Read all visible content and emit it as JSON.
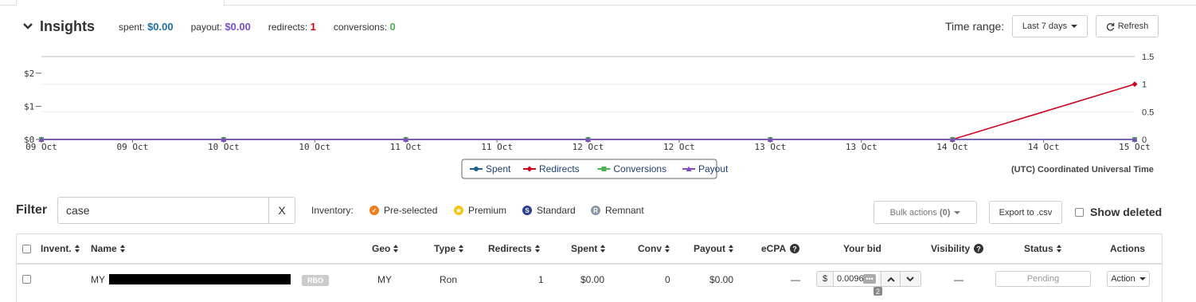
{
  "header": {
    "title": "Insights",
    "stats": {
      "spent_label": "spent:",
      "spent_value": "$0.00",
      "payout_label": "payout:",
      "payout_value": "$0.00",
      "redirects_label": "redirects:",
      "redirects_value": "1",
      "conversions_label": "conversions:",
      "conversions_value": "0"
    },
    "time_range_label": "Time range:",
    "time_range_value": "Last 7 days",
    "refresh_label": "Refresh"
  },
  "chart_data": {
    "type": "line",
    "x_ticks": [
      "09 Oct",
      "09 Oct",
      "10 Oct",
      "10 Oct",
      "11 Oct",
      "11 Oct",
      "12 Oct",
      "12 Oct",
      "13 Oct",
      "13 Oct",
      "14 Oct",
      "14 Oct",
      "15 Oct"
    ],
    "x": [
      "09 Oct",
      "10 Oct",
      "11 Oct",
      "12 Oct",
      "13 Oct",
      "14 Oct",
      "15 Oct"
    ],
    "left_axis": {
      "ticks": [
        "$0",
        "$1",
        "$2"
      ],
      "ylim": [
        0,
        2.5
      ]
    },
    "right_axis": {
      "ticks": [
        "0",
        "0.5",
        "1",
        "1.5"
      ],
      "ylim": [
        0,
        1.5
      ]
    },
    "series": [
      {
        "name": "Spent",
        "axis": "left",
        "color": "#1f5f8b",
        "values": [
          0,
          0,
          0,
          0,
          0,
          0,
          0
        ]
      },
      {
        "name": "Redirects",
        "axis": "right",
        "color": "#d0021b",
        "values": [
          0,
          0,
          0,
          0,
          0,
          0,
          1
        ]
      },
      {
        "name": "Conversions",
        "axis": "right",
        "color": "#4caf50",
        "values": [
          0,
          0,
          0,
          0,
          0,
          0,
          0
        ]
      },
      {
        "name": "Payout",
        "axis": "left",
        "color": "#7a4fc5",
        "values": [
          0,
          0,
          0,
          0,
          0,
          0,
          0
        ]
      }
    ],
    "grid": true,
    "legend_position": "bottom-center",
    "timezone_note": "(UTC) Coordinated Universal Time"
  },
  "filter": {
    "label": "Filter",
    "value": "case",
    "clear_label": "X",
    "inventory_label": "Inventory:",
    "inventory_items": [
      {
        "label": "Pre-selected",
        "color": "#f07d1e"
      },
      {
        "label": "Premium",
        "color": "#f5c518"
      },
      {
        "label": "Standard",
        "color": "#2a3f8f"
      },
      {
        "label": "Remnant",
        "color": "#8a97a8"
      }
    ],
    "bulk_actions_label": "Bulk actions",
    "bulk_count": "(0)",
    "export_label": "Export to .csv",
    "show_deleted_label": "Show deleted"
  },
  "table": {
    "columns": [
      "Invent.",
      "Name",
      "Geo",
      "Type",
      "Redirects",
      "Spent",
      "Conv",
      "Payout",
      "eCPA",
      "Your bid",
      "Visibility",
      "Status",
      "Actions"
    ],
    "rows": [
      {
        "name": "MY",
        "tag": "RBO",
        "geo": "MY",
        "type": "Ron",
        "redirects": "1",
        "spent": "$0.00",
        "conv": "0",
        "payout": "$0.00",
        "ecpa": "—",
        "bid_currency": "$",
        "bid": "0.0096",
        "bid_dots": "•••",
        "bid_badge": "2",
        "visibility": "—",
        "status": "Pending",
        "action": "Action"
      }
    ]
  }
}
